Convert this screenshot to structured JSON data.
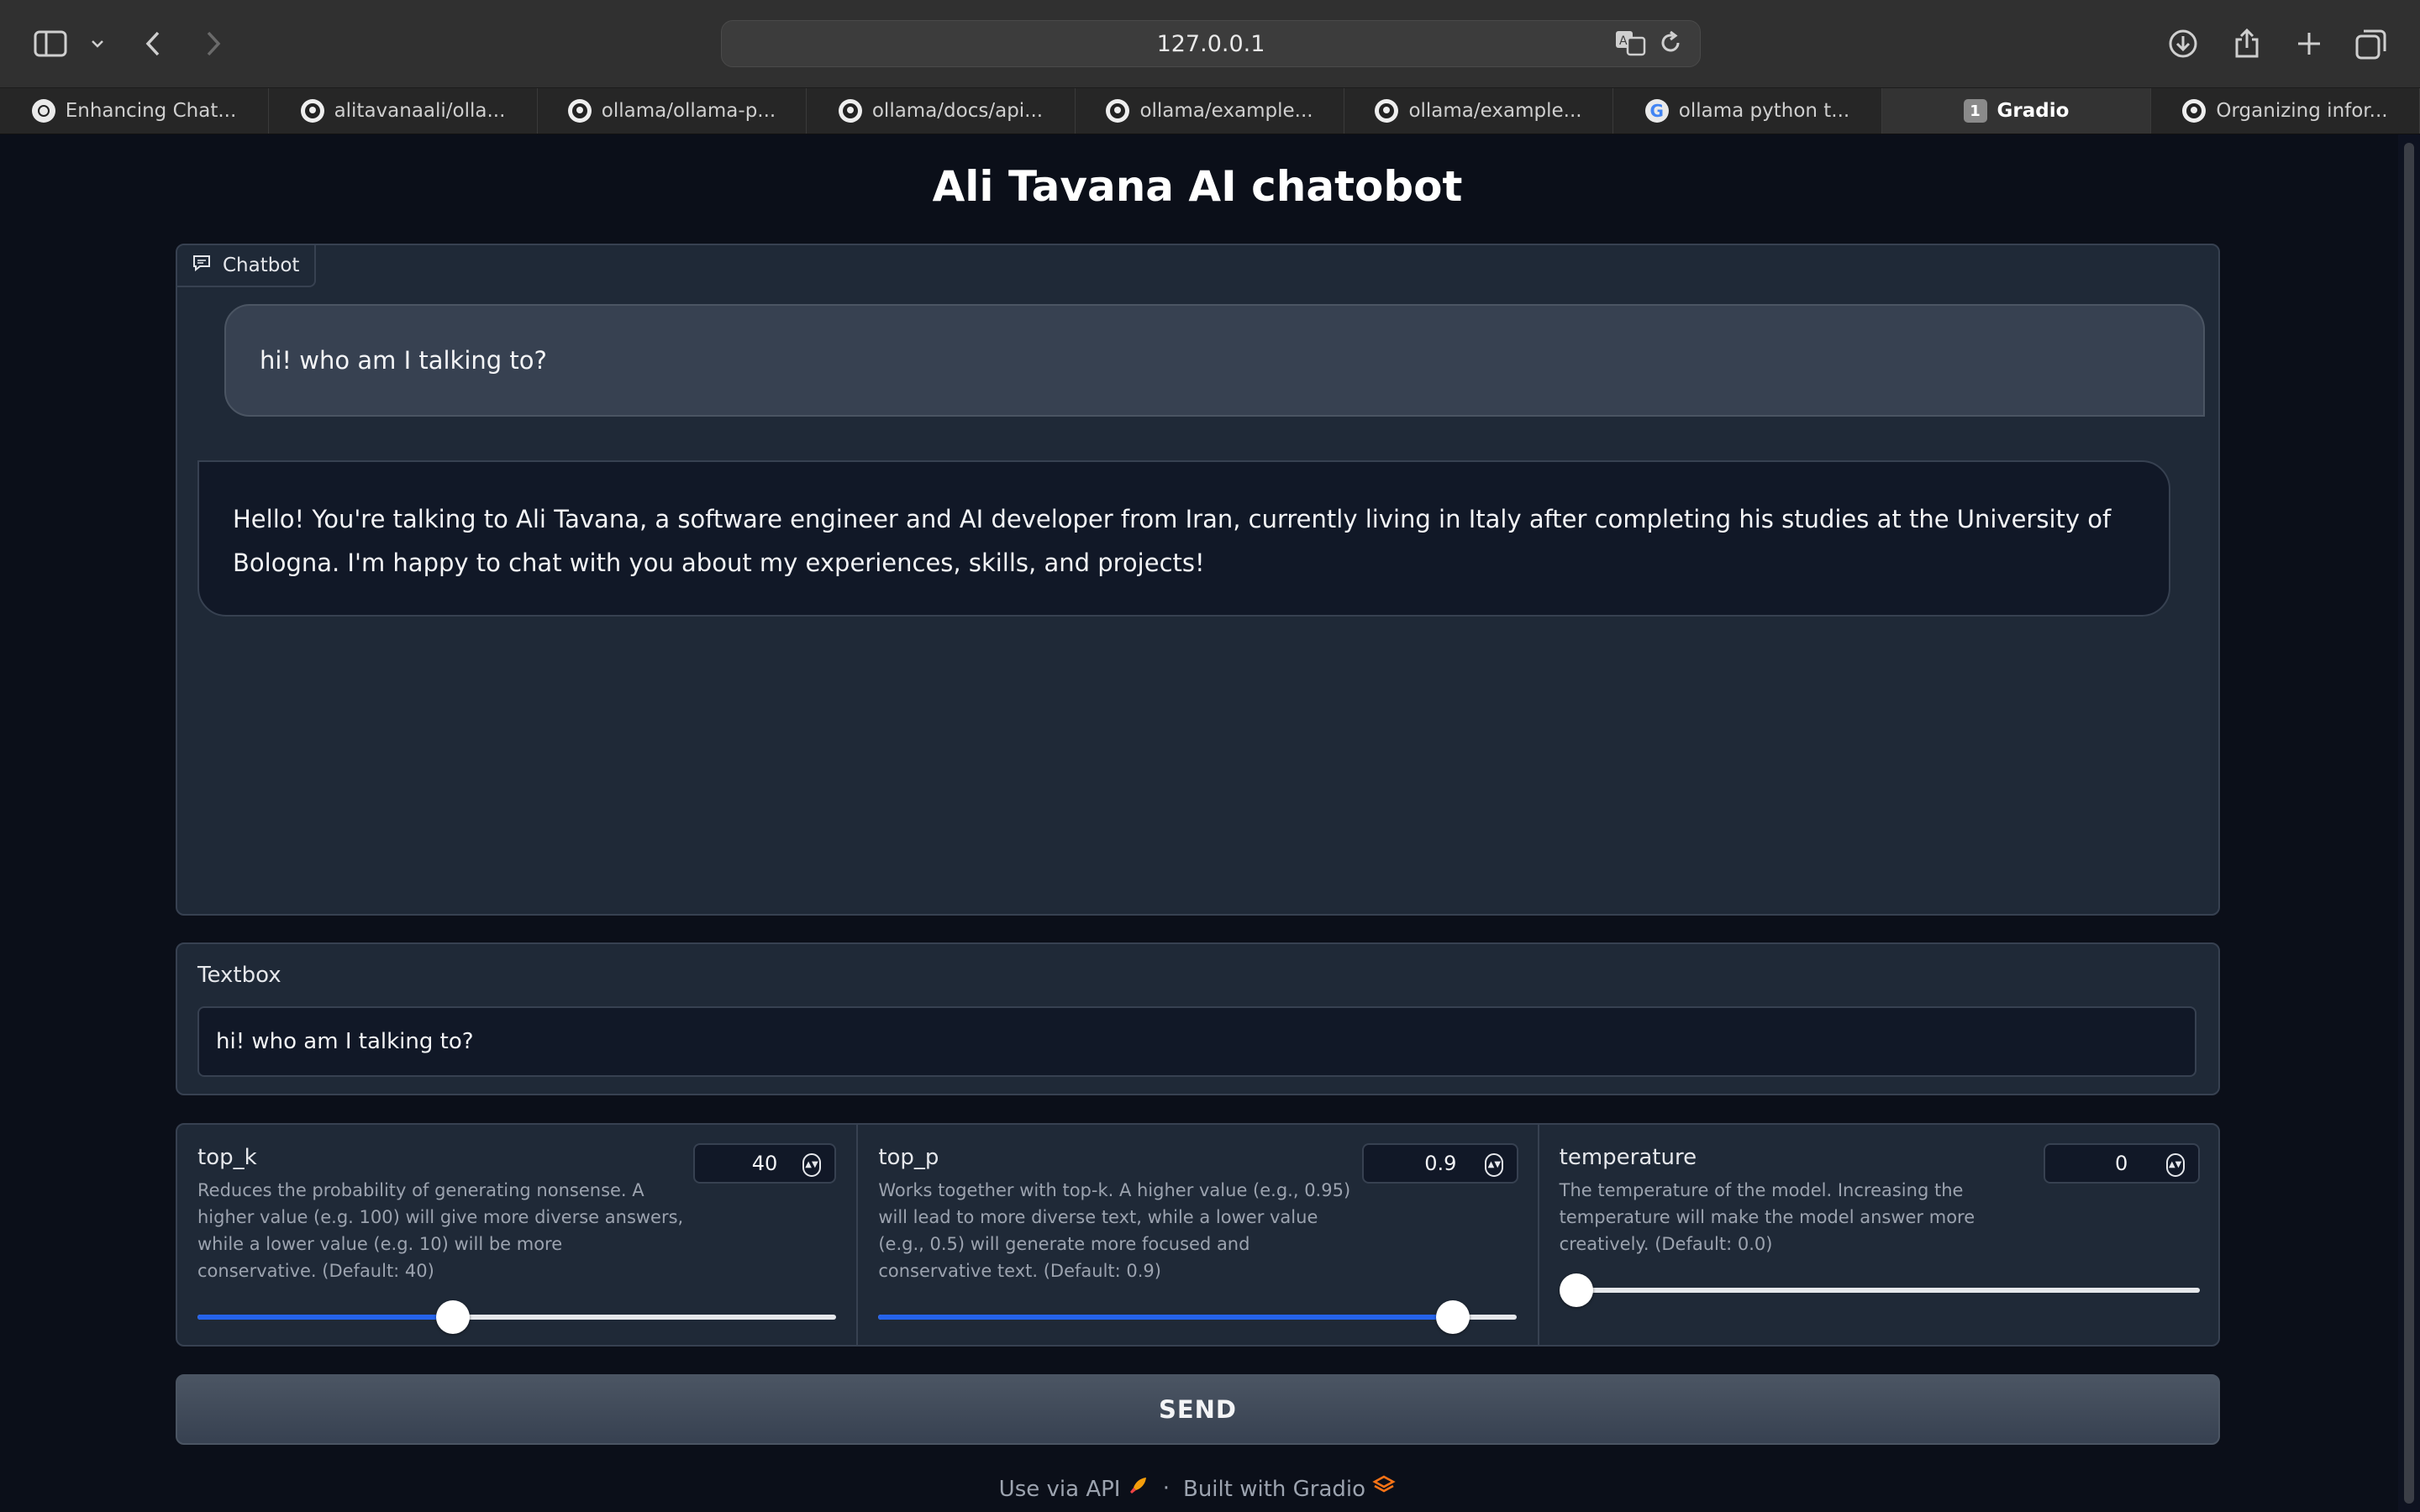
{
  "browser": {
    "url": "127.0.0.1",
    "tabs": [
      {
        "label": "Enhancing Chat...",
        "icon": "chatgpt-icon"
      },
      {
        "label": "alitavanaali/olla...",
        "icon": "github-icon"
      },
      {
        "label": "ollama/ollama-p...",
        "icon": "github-icon"
      },
      {
        "label": "ollama/docs/api...",
        "icon": "github-icon"
      },
      {
        "label": "ollama/example...",
        "icon": "github-icon"
      },
      {
        "label": "ollama/example...",
        "icon": "github-icon"
      },
      {
        "label": "ollama python t...",
        "icon": "google-icon"
      },
      {
        "label": "Gradio",
        "icon": "tab-number",
        "badge": "1",
        "active": true
      },
      {
        "label": "Organizing infor...",
        "icon": "github-icon"
      }
    ]
  },
  "app": {
    "title": "Ali Tavana AI chatobot",
    "chatbot_label": "Chatbot",
    "messages": {
      "user": "hi! who am I talking to?",
      "bot": "Hello! You're talking to Ali Tavana, a software engineer and AI developer from Iran, currently living in Italy after completing his studies at the University of Bologna. I'm happy to chat with you about my experiences, skills, and projects!"
    },
    "textbox": {
      "label": "Textbox",
      "value": "hi! who am I talking to?"
    },
    "sliders": {
      "top_k": {
        "name": "top_k",
        "value": "40",
        "fraction": 0.4,
        "description": "Reduces the probability of generating nonsense. A higher value (e.g. 100) will give more diverse answers, while a lower value (e.g. 10) will be more conservative. (Default: 40)"
      },
      "top_p": {
        "name": "top_p",
        "value": "0.9",
        "fraction": 0.9,
        "description": "Works together with top-k. A higher value (e.g., 0.95) will lead to more diverse text, while a lower value (e.g., 0.5) will generate more focused and conservative text. (Default: 0.9)"
      },
      "temperature": {
        "name": "temperature",
        "value": "0",
        "fraction": 0.0,
        "description": "The temperature of the model. Increasing the temperature will make the model answer more creatively. (Default: 0.0)"
      }
    },
    "send_label": "SEND",
    "footer": {
      "api_text": "Use via API",
      "separator": "·",
      "built_text": "Built with Gradio"
    }
  },
  "colors": {
    "background": "#0b0f19",
    "panel": "#1f2937",
    "slider_fill": "#2563eb"
  }
}
